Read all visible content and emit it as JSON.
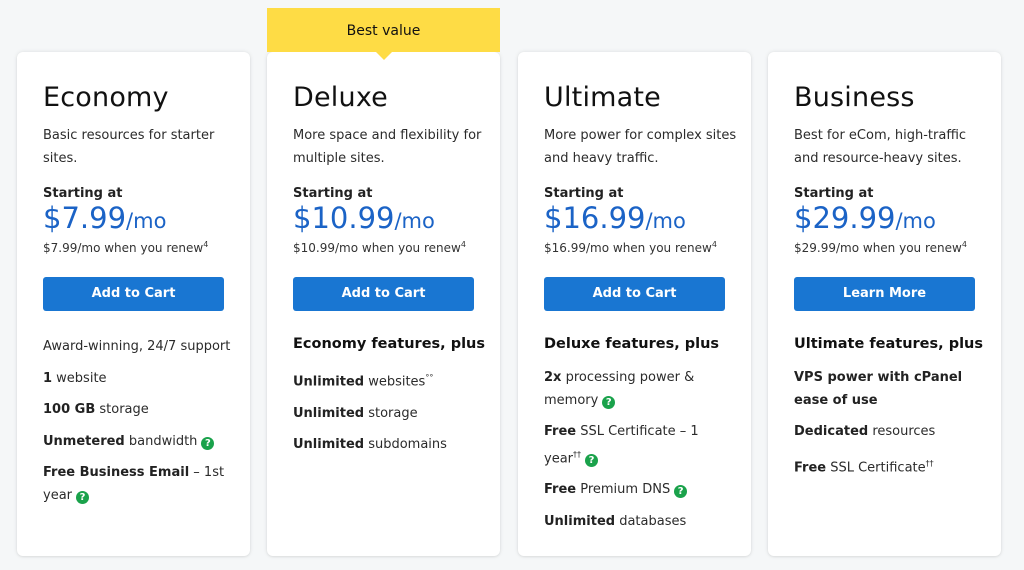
{
  "ribbon": {
    "label": "Best value"
  },
  "plans": [
    {
      "name": "Economy",
      "desc": "Basic resources for starter sites.",
      "starting_label": "Starting at",
      "price": "$7.99",
      "per": "/mo",
      "renew": "$7.99/mo when you renew",
      "renew_sup": "4",
      "cta": "Add to Cart",
      "features_heading": "",
      "features": [
        {
          "strong": "",
          "text": "Award-winning, 24/7 support",
          "sup": "",
          "help": false
        },
        {
          "strong": "1",
          "text": " website",
          "sup": "",
          "help": false
        },
        {
          "strong": "100 GB",
          "text": " storage",
          "sup": "",
          "help": false
        },
        {
          "strong": "Unmetered",
          "text": " bandwidth",
          "sup": "",
          "help": true
        },
        {
          "strong": "Free Business Email",
          "text": " – 1st year",
          "sup": "",
          "help": true
        }
      ]
    },
    {
      "name": "Deluxe",
      "desc": "More space and flexibility for multiple sites.",
      "starting_label": "Starting at",
      "price": "$10.99",
      "per": "/mo",
      "renew": "$10.99/mo when you renew",
      "renew_sup": "4",
      "cta": "Add to Cart",
      "features_heading": "Economy features, plus",
      "features": [
        {
          "strong": "Unlimited",
          "text": " websites",
          "sup": "°°",
          "help": false
        },
        {
          "strong": "Unlimited",
          "text": " storage",
          "sup": "",
          "help": false
        },
        {
          "strong": "Unlimited",
          "text": " subdomains",
          "sup": "",
          "help": false
        }
      ]
    },
    {
      "name": "Ultimate",
      "desc": "More power for complex sites and heavy traffic.",
      "starting_label": "Starting at",
      "price": "$16.99",
      "per": "/mo",
      "renew": "$16.99/mo when you renew",
      "renew_sup": "4",
      "cta": "Add to Cart",
      "features_heading": "Deluxe features, plus",
      "features": [
        {
          "strong": "2x",
          "text": " processing power & memory",
          "sup": "",
          "help": true
        },
        {
          "strong": "Free",
          "text": " SSL Certificate – 1 year",
          "sup": "††",
          "help": true
        },
        {
          "strong": "Free",
          "text": " Premium DNS",
          "sup": "",
          "help": true
        },
        {
          "strong": "Unlimited",
          "text": " databases",
          "sup": "",
          "help": false
        }
      ]
    },
    {
      "name": "Business",
      "desc": "Best for eCom, high-traffic and resource-heavy sites.",
      "starting_label": "Starting at",
      "price": "$29.99",
      "per": "/mo",
      "renew": "$29.99/mo when you renew",
      "renew_sup": "4",
      "cta": "Learn More",
      "features_heading": "Ultimate features, plus",
      "features": [
        {
          "strong": "VPS power with cPanel ease of use",
          "text": "",
          "sup": "",
          "help": false
        },
        {
          "strong": "Dedicated",
          "text": " resources",
          "sup": "",
          "help": false
        },
        {
          "strong": "Free",
          "text": " SSL Certificate",
          "sup": "††",
          "help": false
        }
      ]
    }
  ],
  "help_icon": {
    "glyph": "?",
    "name": "help-icon"
  },
  "colors": {
    "price": "#1b63c6",
    "button": "#1976d2",
    "ribbon": "#fedc45",
    "help": "#1aa24b"
  }
}
